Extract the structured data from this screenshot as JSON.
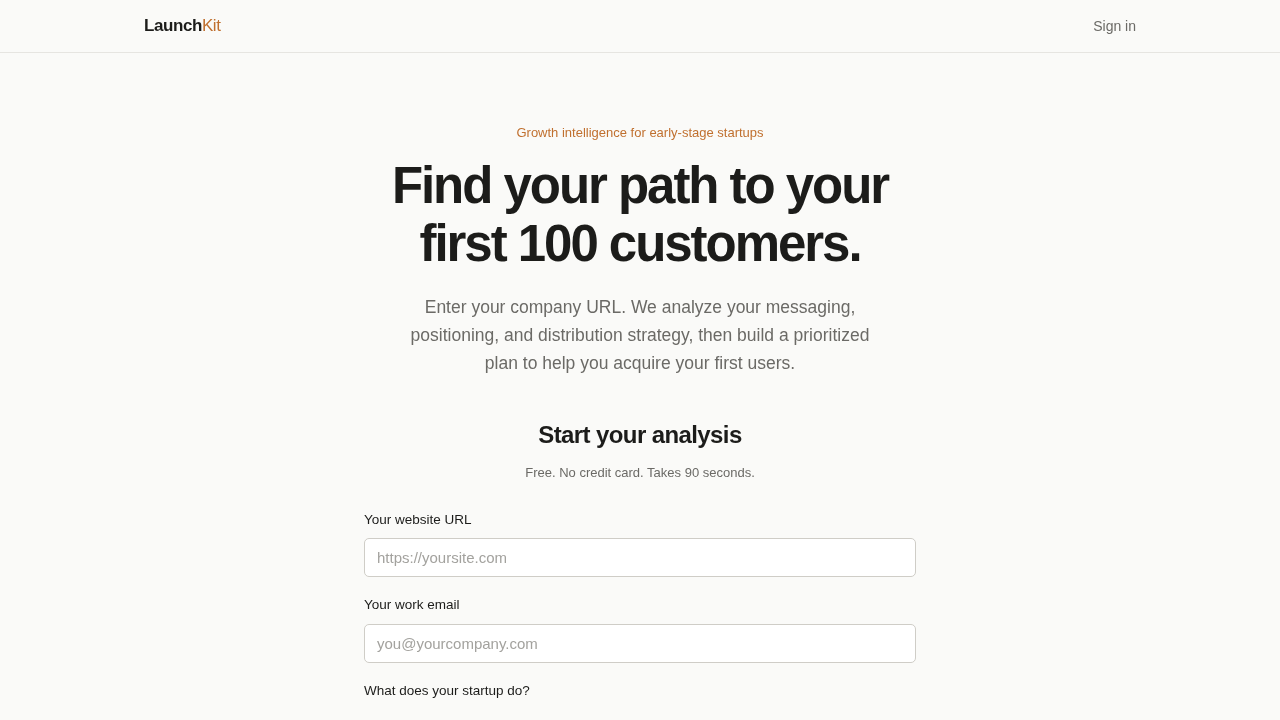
{
  "header": {
    "logo": {
      "primary": "Launch",
      "accent": "Kit"
    },
    "sign_in": "Sign in"
  },
  "hero": {
    "eyebrow": "Growth intelligence for early-stage startups",
    "title_lines": [
      "Find your path to your",
      "first 100 customers."
    ],
    "description": "Enter your company URL. We analyze your messaging, positioning, and distribution strategy, then build a prioritized plan to help you acquire your first users."
  },
  "form": {
    "title": "Start your analysis",
    "subtitle": "Free. No credit card. Takes 90 seconds.",
    "fields": [
      {
        "label": "Your website URL",
        "placeholder": "https://yoursite.com",
        "kind": "input"
      },
      {
        "label": "Your work email",
        "placeholder": "you@yourcompany.com",
        "kind": "input"
      },
      {
        "label": "What does your startup do?",
        "kind": "label_only"
      }
    ]
  }
}
